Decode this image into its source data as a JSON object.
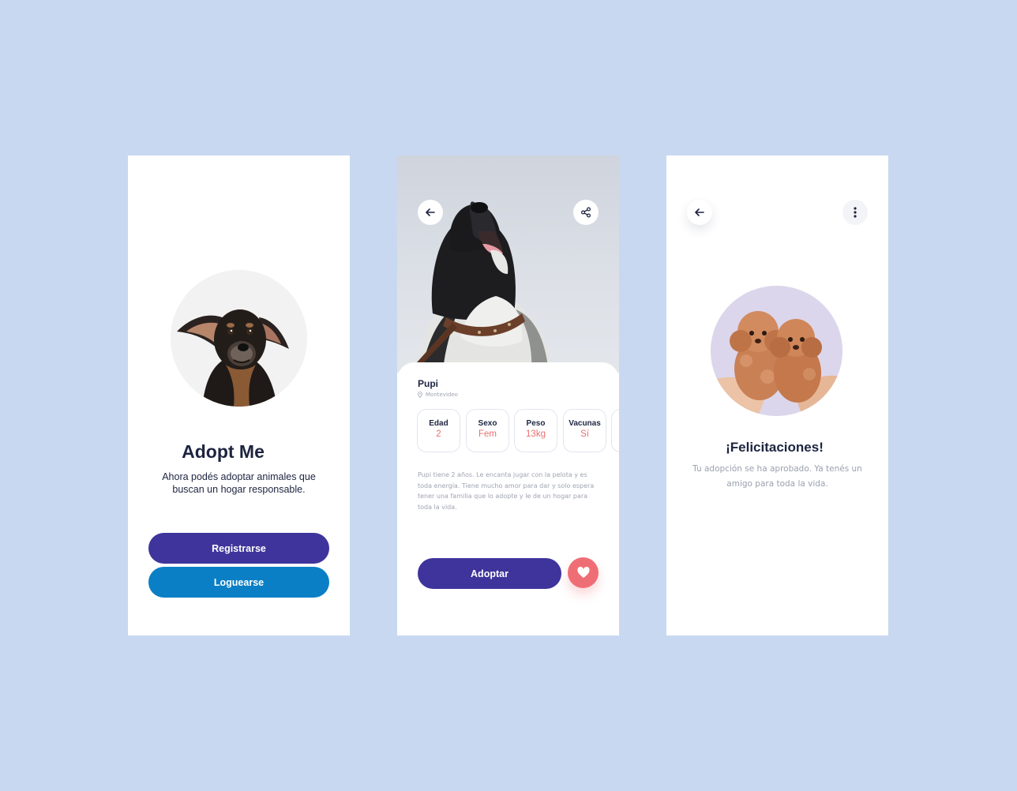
{
  "welcome": {
    "title": "Adopt Me",
    "subtitle": "Ahora podés adoptar animales que buscan un hogar responsable.",
    "register_label": "Registrarse",
    "login_label": "Loguearse"
  },
  "detail": {
    "pet_name": "Pupi",
    "location": "Montevideo",
    "stats": [
      {
        "label": "Edad",
        "value": "2"
      },
      {
        "label": "Sexo",
        "value": "Fem"
      },
      {
        "label": "Peso",
        "value": "13kg"
      },
      {
        "label": "Vacunas",
        "value": "Sí"
      }
    ],
    "description": "Pupi tiene 2 años. Le encanta jugar con la pelota y es toda energía. Tiene mucho amor para dar y solo espera tener una familia que lo adopte y le de un hogar para toda la vida.",
    "adopt_label": "Adoptar"
  },
  "success": {
    "title": "¡Felicitaciones!",
    "message": "Tu adopción se ha aprobado. Ya tenés un amigo para toda la vida."
  },
  "icons": {
    "back": "arrow-left-icon",
    "share": "share-icon",
    "favorite": "heart-icon",
    "menu": "more-vertical-icon",
    "location": "location-pin-icon"
  },
  "colors": {
    "background": "#c8d8f1",
    "primary": "#3e349b",
    "secondary": "#0a7fc5",
    "accent": "#ef6e75",
    "text_dark": "#1d2440",
    "text_muted": "#a0a4b2"
  }
}
